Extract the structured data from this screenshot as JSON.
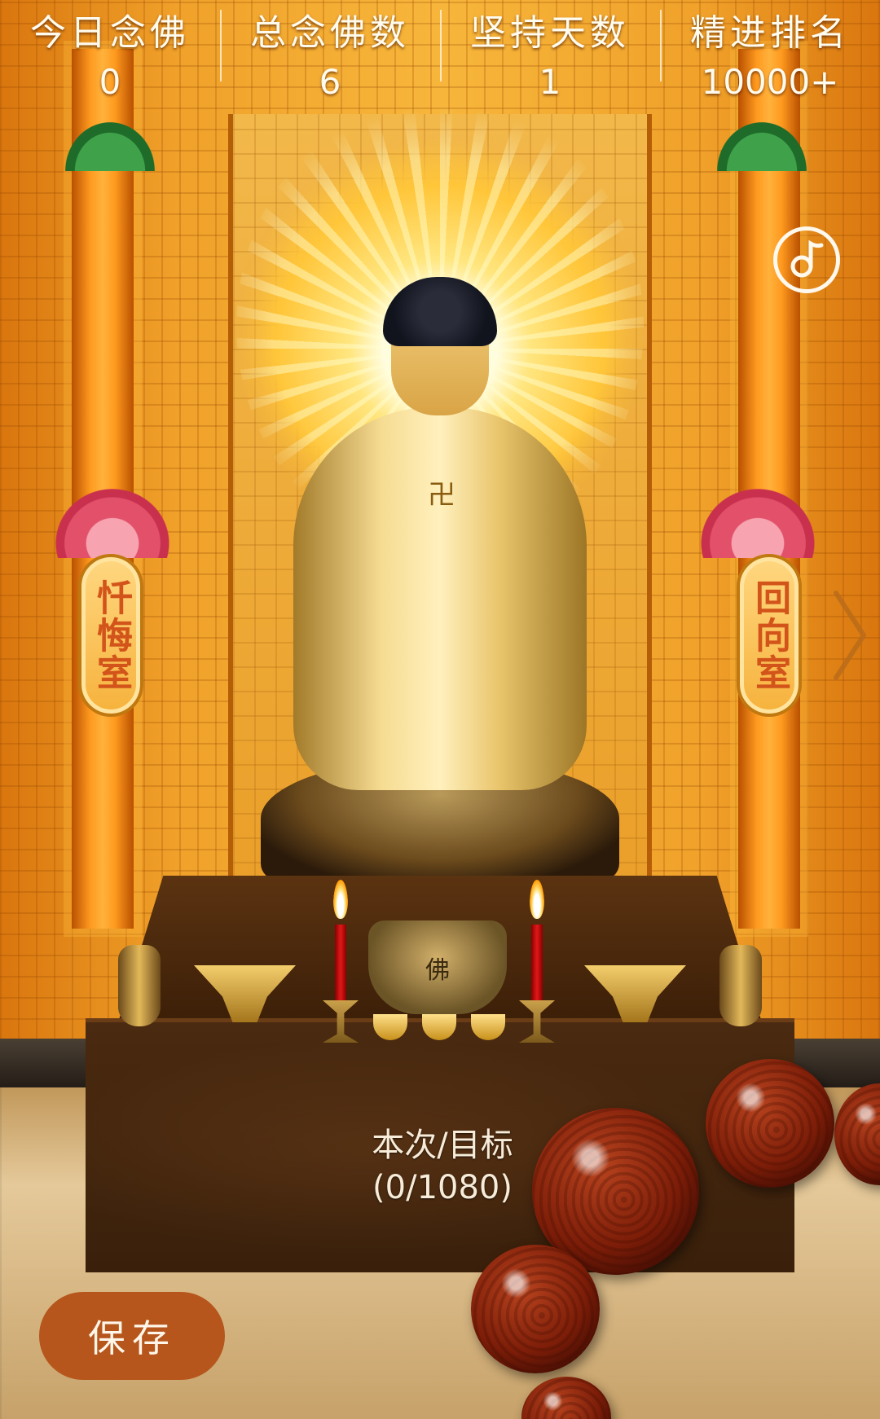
{
  "stats": [
    {
      "label": "今日念佛",
      "value": "0"
    },
    {
      "label": "总念佛数",
      "value": "6"
    },
    {
      "label": "坚持天数",
      "value": "1"
    },
    {
      "label": "精进排名",
      "value": "10000+"
    }
  ],
  "plaques": {
    "left": "忏悔室",
    "right": "回向室"
  },
  "censer_label": "佛",
  "counter": {
    "label": "本次/目标",
    "progress": "(0/1080)"
  },
  "save_label": "保存",
  "icons": {
    "music": "music-note-icon",
    "next": "chevron-right-icon"
  },
  "colors": {
    "save_button": "#b6561c",
    "stat_text": "#fffbee",
    "candle": "#e01818"
  }
}
